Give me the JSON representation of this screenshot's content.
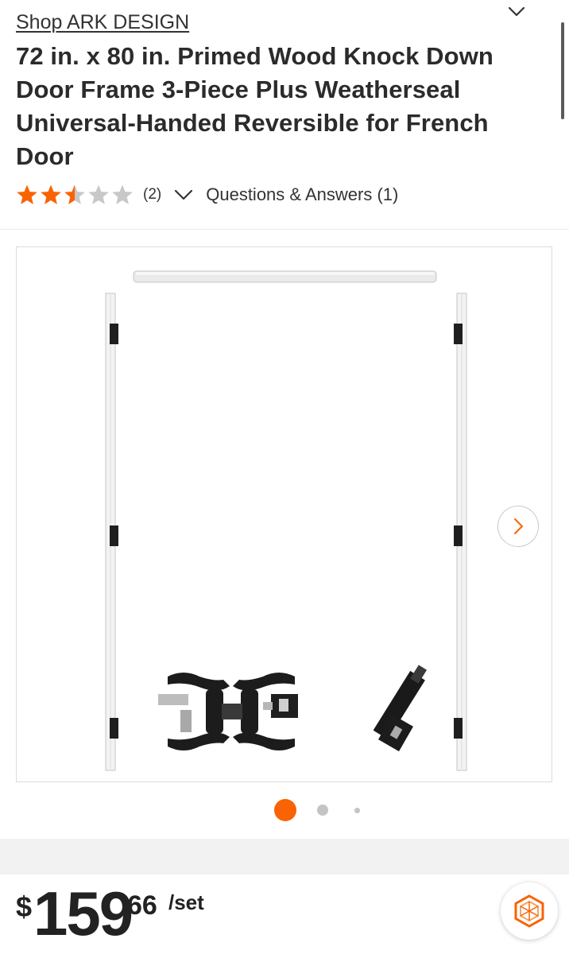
{
  "header": {
    "shop_link": "Shop ARK DESIGN",
    "collapse_icon": "chevron-down-icon"
  },
  "product": {
    "title": "72 in. x 80 in. Primed Wood Knock Down Door Frame 3-Piece Plus Weatherseal Universal-Handed Reversible for French Door",
    "rating": 2.5,
    "rating_max": 5,
    "review_count": "(2)",
    "qa_label": "Questions & Answers (1)"
  },
  "gallery": {
    "image_description_icon": "product-image",
    "next_icon": "chevron-right-icon",
    "total_slides": 3,
    "active_slide": 1
  },
  "price": {
    "currency": "$",
    "dollars": "159",
    "cents": "66",
    "unit": "/set"
  },
  "assistant": {
    "icon": "hexagon-logo-icon"
  },
  "colors": {
    "accent": "#f96302",
    "star_empty": "#c8c8c8",
    "text": "#222222"
  }
}
